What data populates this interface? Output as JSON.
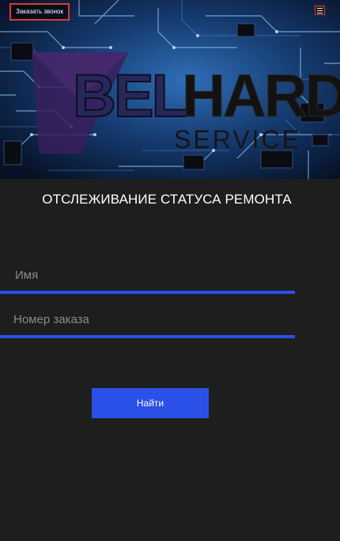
{
  "header": {
    "callback_label": "Заказать звонок",
    "menu_icon": "hamburger-menu-icon"
  },
  "logo": {
    "bel": "BEL",
    "hard": "HARD",
    "service": "SERVICE"
  },
  "form": {
    "title": "ОТСЛЕЖИВАНИЕ СТАТУСА РЕМОНТА",
    "name_placeholder": "Имя",
    "name_value": "",
    "order_placeholder": "Номер заказа",
    "order_value": "",
    "submit_label": "Найти"
  },
  "colors": {
    "accent": "#2b50e8",
    "callback_border": "#e0392b",
    "background": "#1e1e1f"
  }
}
